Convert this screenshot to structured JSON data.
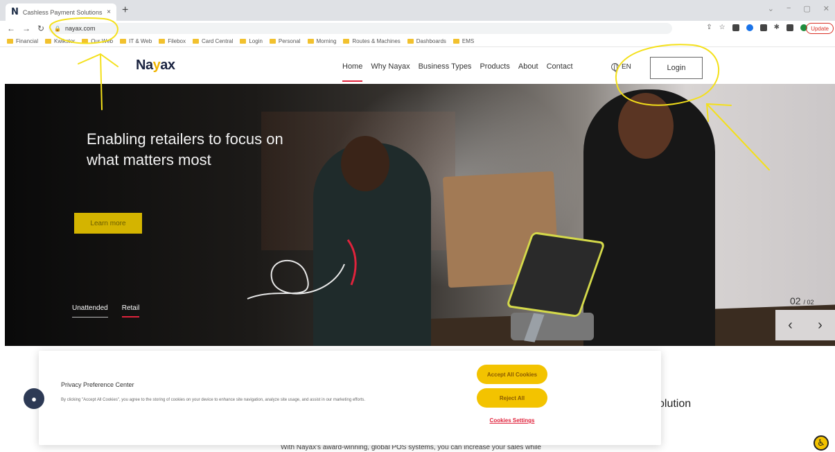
{
  "browser": {
    "tab_title": "Cashless Payment Solutions - U...",
    "tab_close": "×",
    "new_tab": "+",
    "url": "nayax.com",
    "update_label": "Update",
    "window_controls": [
      "⌄",
      "−",
      "▢",
      "✕"
    ],
    "bookmarks": [
      "Financial",
      "Kwikstor",
      "Our Web",
      "IT & Web",
      "Filebox",
      "Card Central",
      "Login",
      "Personal",
      "Morning",
      "Routes & Machines",
      "Dashboards",
      "EMS"
    ]
  },
  "site": {
    "logo_text_a": "Na",
    "logo_text_y": "y",
    "logo_text_b": "ax",
    "nav": [
      "Home",
      "Why Nayax",
      "Business Types",
      "Products",
      "About",
      "Contact"
    ],
    "lang": "EN",
    "login": "Login"
  },
  "hero": {
    "headline": "Enabling retailers to focus on what matters most",
    "cta": "Learn more",
    "tabs": [
      "Unattended",
      "Retail"
    ],
    "slide_current": "02",
    "slide_total": "/ 02",
    "prev": "‹",
    "next": "›"
  },
  "cookie": {
    "title": "Privacy Preference Center",
    "description": "By clicking \"Accept All Cookies\", you agree to the storing of cookies on your device to enhance site navigation, analyze site usage, and assist in our marketing efforts.",
    "accept": "Accept All Cookies",
    "reject": "Reject All",
    "settings": "Cookies Settings"
  },
  "below": {
    "solution": "olution",
    "bottom_text": "With Nayax's award-winning, global POS systems, you can increase your sales while"
  },
  "colors": {
    "brand_yellow": "#f3c300",
    "accent_red": "#e0233c",
    "annotation": "#f4e01a"
  }
}
